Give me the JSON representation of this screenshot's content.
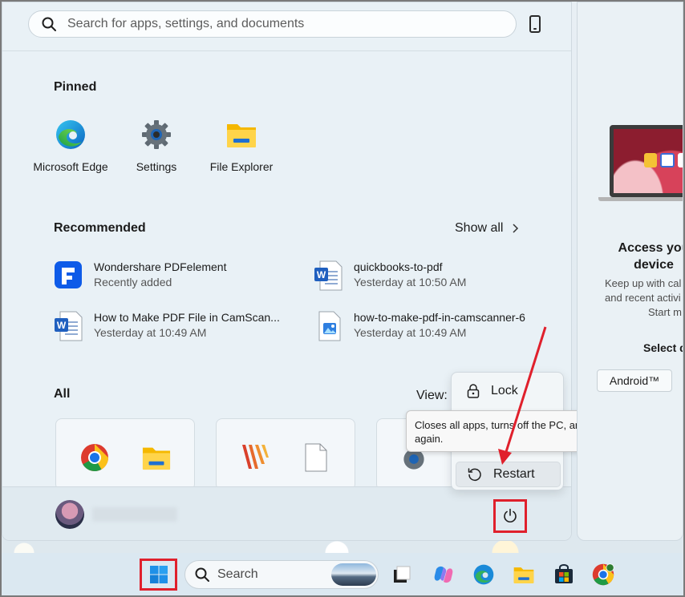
{
  "start_menu": {
    "search_placeholder": "Search for apps, settings, and documents",
    "pinned": {
      "title": "Pinned",
      "apps": [
        {
          "label": "Microsoft Edge",
          "icon": "edge-icon"
        },
        {
          "label": "Settings",
          "icon": "settings-gear-icon"
        },
        {
          "label": "File Explorer",
          "icon": "folder-icon"
        }
      ]
    },
    "recommended": {
      "title": "Recommended",
      "show_all": "Show all",
      "items": [
        {
          "name": "Wondershare PDFelement",
          "sub": "Recently added",
          "icon": "pdfelement-icon"
        },
        {
          "name": "quickbooks-to-pdf",
          "sub": "Yesterday at 10:50 AM",
          "icon": "word-doc-icon"
        },
        {
          "name": "How to Make PDF File in CamScan...",
          "sub": "Yesterday at 10:49 AM",
          "icon": "word-doc-icon"
        },
        {
          "name": "how-to-make-pdf-in-camscanner-6",
          "sub": "Yesterday at 10:49 AM",
          "icon": "image-file-icon"
        }
      ]
    },
    "all": {
      "title": "All",
      "view_label": "View: C"
    }
  },
  "power_menu": {
    "lock": "Lock",
    "restart": "Restart",
    "tooltip": "Closes all apps, turns off the PC, and then turns it on again."
  },
  "right_panel": {
    "title_line1": "Access you",
    "title_line2": "device",
    "body_line1": "Keep up with cal",
    "body_line2": "and recent activi",
    "body_line3": "Start m",
    "select_label": "Select de",
    "android_button": "Android™"
  },
  "taskbar": {
    "search_label": "Search"
  },
  "colors": {
    "highlight_red": "#e0202c",
    "menu_bg": "#e9f1f6"
  }
}
